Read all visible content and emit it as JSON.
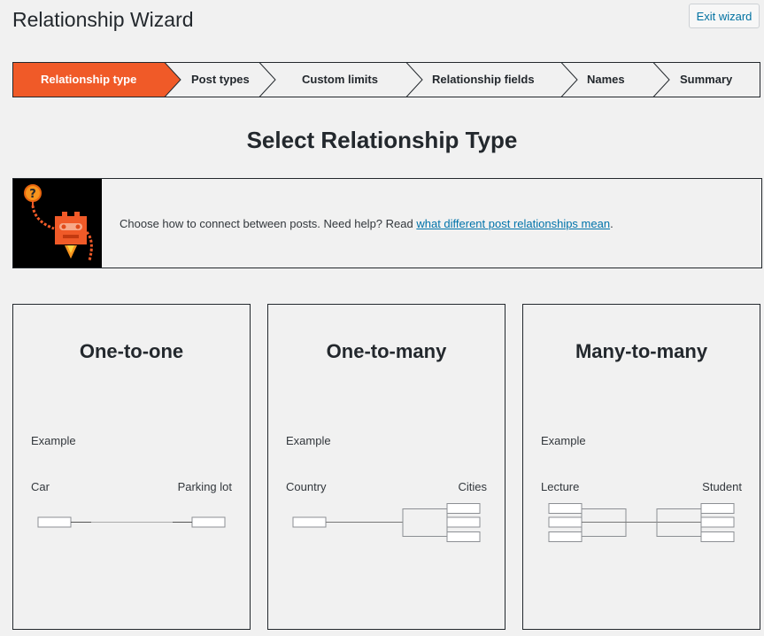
{
  "page": {
    "title": "Relationship Wizard",
    "exit_label": "Exit wizard",
    "heading": "Select Relationship Type"
  },
  "steps": [
    {
      "label": "Relationship type",
      "active": true
    },
    {
      "label": "Post types",
      "active": false
    },
    {
      "label": "Custom limits",
      "active": false
    },
    {
      "label": "Relationship fields",
      "active": false
    },
    {
      "label": "Names",
      "active": false
    },
    {
      "label": "Summary",
      "active": false
    }
  ],
  "notice": {
    "text": "Choose how to connect between posts. Need help? Read ",
    "link": "what different post relationships mean",
    "suffix": "."
  },
  "cards": [
    {
      "title": "One-to-one",
      "example": "Example",
      "left": "Car",
      "right": "Parking lot"
    },
    {
      "title": "One-to-many",
      "example": "Example",
      "left": "Country",
      "right": "Cities"
    },
    {
      "title": "Many-to-many",
      "example": "Example",
      "left": "Lecture",
      "right": "Student"
    }
  ],
  "colors": {
    "accent": "#f05a28",
    "text": "#23282d",
    "link": "#0073aa"
  },
  "icons": {
    "robot": "robot-mascot-icon",
    "question": "question-bubble-icon"
  }
}
